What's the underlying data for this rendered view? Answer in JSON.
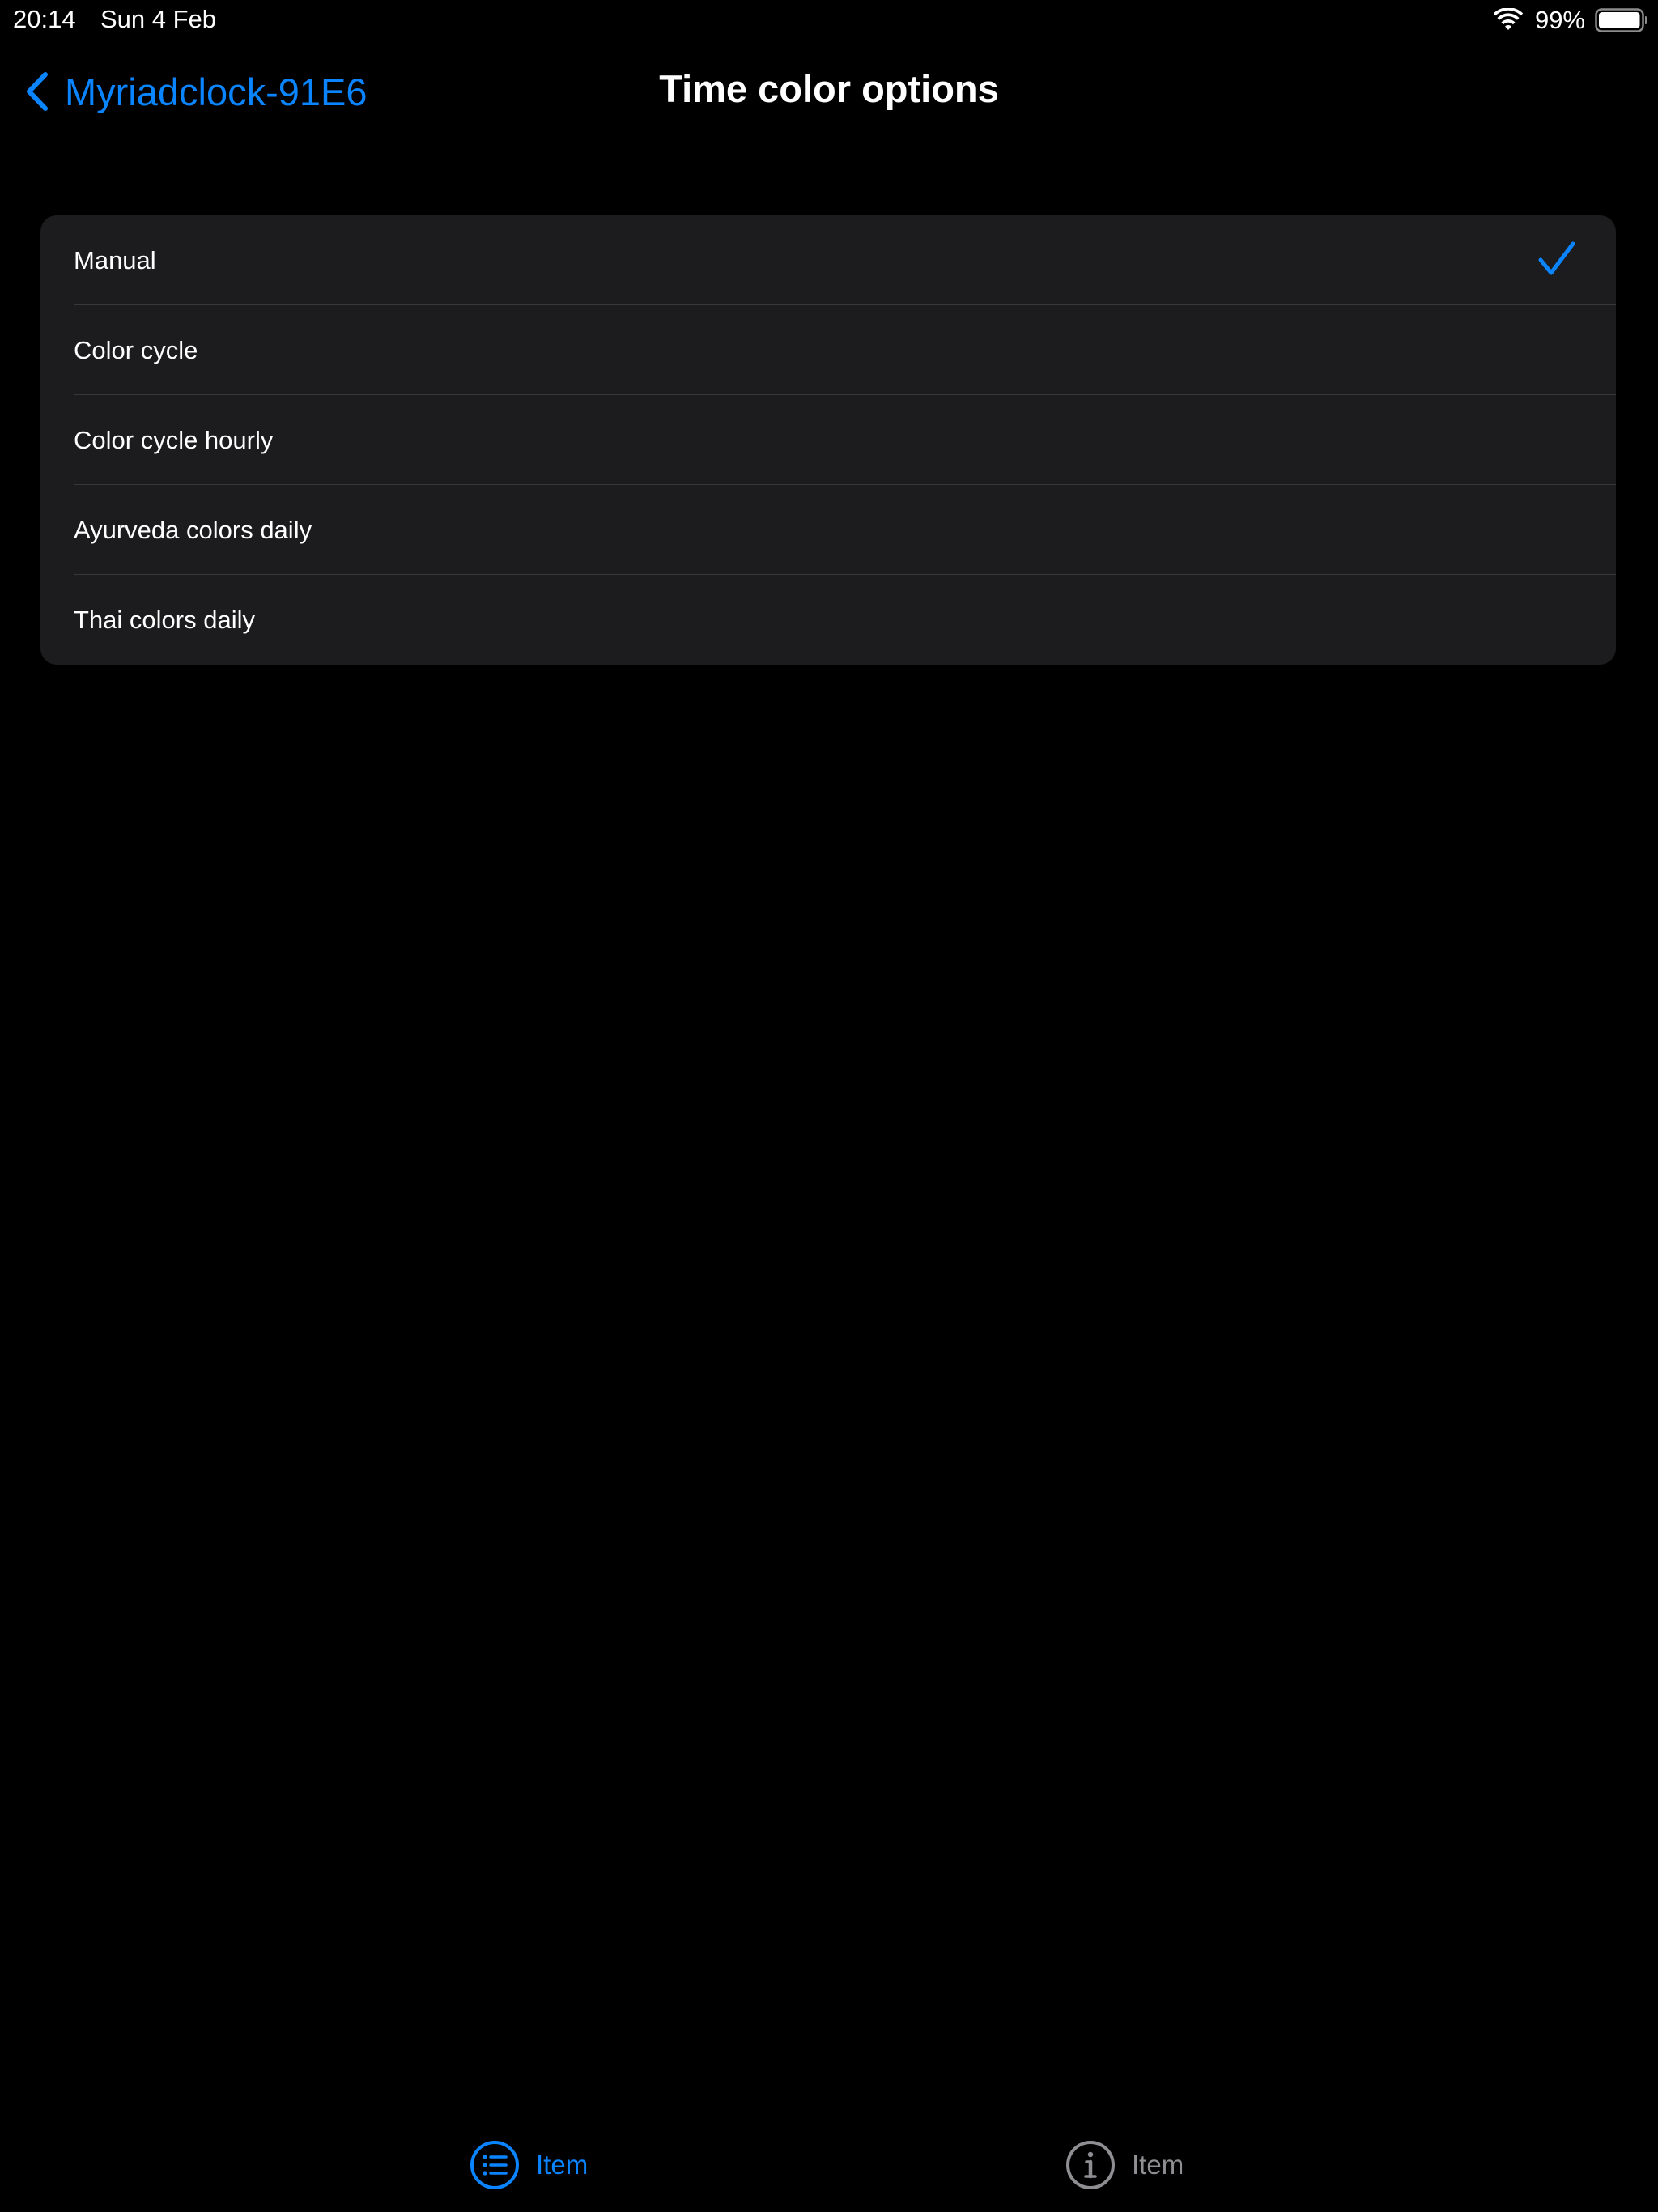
{
  "status_bar": {
    "time": "20:14",
    "date": "Sun 4 Feb",
    "battery_percent": "99%",
    "battery_level": 0.99,
    "icons": [
      "wifi-icon",
      "battery-icon"
    ]
  },
  "nav": {
    "back_label": "Myriadclock-91E6",
    "title": "Time color options",
    "back_icon": "chevron-left-icon"
  },
  "options": {
    "items": [
      {
        "label": "Manual",
        "selected": true
      },
      {
        "label": "Color cycle",
        "selected": false
      },
      {
        "label": "Color cycle hourly",
        "selected": false
      },
      {
        "label": "Ayurveda colors daily",
        "selected": false
      },
      {
        "label": "Thai colors daily",
        "selected": false
      }
    ],
    "selected_icon": "checkmark-icon"
  },
  "tab_bar": {
    "tabs": [
      {
        "label": "Item",
        "icon": "list-bullet-circle-icon",
        "active": true
      },
      {
        "label": "Item",
        "icon": "info-circle-icon",
        "active": false
      }
    ]
  },
  "colors": {
    "accent": "#0a84ff",
    "background": "#000000",
    "group_background": "#1c1c1e",
    "separator": "#38383a",
    "inactive": "#8e8e93"
  }
}
